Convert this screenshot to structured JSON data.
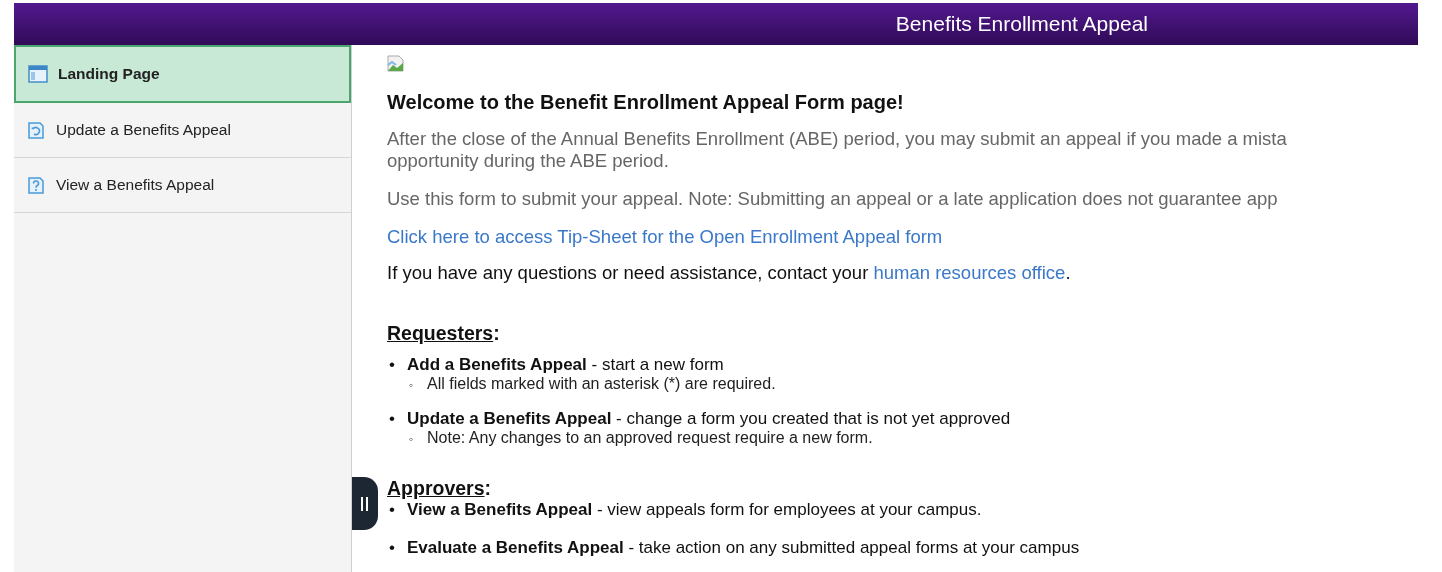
{
  "header": {
    "title": "Benefits Enrollment Appeal"
  },
  "sidebar": {
    "items": [
      {
        "label": "Landing Page",
        "selected": true,
        "kind": "page"
      },
      {
        "label": "Update a Benefits Appeal",
        "selected": false,
        "kind": "refresh"
      },
      {
        "label": "View a Benefits Appeal",
        "selected": false,
        "kind": "help"
      }
    ]
  },
  "content": {
    "heading": "Welcome to the Benefit Enrollment Appeal Form page!",
    "intro": [
      "After the close of the Annual Benefits Enrollment (ABE) period, you may submit an appeal if you made a mista",
      "opportunity during the ABE period."
    ],
    "note": "Use this form to submit your appeal.  Note: Submitting an appeal or a late application does not guarantee app",
    "tip_link": "Click here to access Tip-Sheet for the Open Enrollment Appeal form",
    "contact": {
      "text": "If you have any questions or need assistance, contact your",
      "link": "human resources office",
      "end": "."
    },
    "sections": [
      {
        "title": "Requesters",
        "suffix": ":",
        "items": [
          {
            "marker": "•",
            "text": "**Add a Benefits Appeal** - start a new form",
            "notes": [
              {
                "marker": "◦",
                "text": "All fields marked with an asterisk (*) are required."
              }
            ]
          },
          {
            "marker": "•",
            "text": "**Update a Benefits Appeal** - change a form you created that is not yet approved",
            "notes": [
              {
                "marker": "◦",
                "text": "Note: Any changes to an approved request require a new form."
              }
            ]
          }
        ]
      },
      {
        "title": "Approvers",
        "suffix": ":",
        "items": [
          {
            "marker": "•",
            "text": "**View a Benefits Appeal** - view appeals form for employees at your campus."
          },
          {
            "marker": "•",
            "text": "**Evaluate a Benefits Appeal** - take action on any submitted appeal forms at your campus"
          }
        ]
      }
    ]
  }
}
